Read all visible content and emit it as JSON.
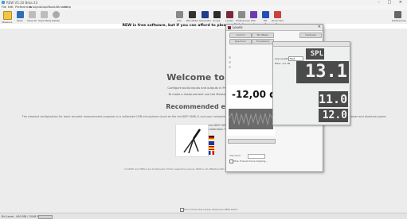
{
  "window": {
    "title": "REW V5.20 Beta 23",
    "controls": "– □ ✕"
  },
  "menu": [
    "File",
    "Edit",
    "Preferences",
    "Analysis",
    "Graph",
    "Tools",
    "Window",
    "Help"
  ],
  "toolbar": {
    "left": [
      {
        "label": "Measure",
        "icon": "measure-icon"
      },
      {
        "label": "Open",
        "icon": "folder-icon"
      },
      {
        "label": "Save All",
        "icon": "save-icon"
      },
      {
        "label": "Save Meas.",
        "icon": "save-icon"
      },
      {
        "label": "Delete",
        "icon": "delete-icon"
      }
    ],
    "right": [
      {
        "label": "Info",
        "icon": "info-icon"
      },
      {
        "label": "RTA Meter",
        "icon": "meter-icon"
      },
      {
        "label": "Generator",
        "icon": "generator-icon"
      },
      {
        "label": "Scope",
        "icon": "scope-icon"
      },
      {
        "label": "Levels",
        "icon": "levels-icon"
      },
      {
        "label": "Preferences",
        "icon": "preferences-icon"
      },
      {
        "label": "RTA",
        "icon": "rta-icon"
      },
      {
        "label": "EQ",
        "icon": "eq-icon"
      },
      {
        "label": "Room Sim",
        "icon": "room-sim-icon"
      }
    ],
    "preferences_label": "Preferences"
  },
  "banner": {
    "before": "REW is free software, but if you can afford to please ",
    "link": "click here",
    "after": " to make a dona"
  },
  "main": {
    "welcome": "Welcome to RE",
    "line1": "Configure audio inputs and outputs in Preferences",
    "line2": "To make a measurement use the Measure button",
    "recommended": "Recommended equip",
    "para": "The simplest configuration for basic acoustic measurement purposes is a calibrated USB microphone (such as the miniDSP UMIK-1) and your computer's headphone output. If that is not available a USB interface with balanced input, phantom power and phantom power.",
    "side_text_1": "miniDSP UM",
    "side_text_2": "calibration fil",
    "footer": "miniDSP and UMIK-1 are trademarks of their respective owners. REW is not affiliated with any of the companies whose products are mentioned.",
    "show_checkbox_label": "Don't show this screen whenever REW starts"
  },
  "status": {
    "left": "Rd Level:",
    "mem": "490 MB / 2048 MB"
  },
  "levels_dialog": {
    "title": "Levels",
    "buttons_row1": [
      "Control",
      "Mic/Meter",
      "Calibrate"
    ],
    "buttons_row2": [
      "Spectrum",
      "Timestamp"
    ],
    "big_level": "-12,00 dB",
    "clip_label": "Clip level",
    "stop_label": "Stop if levels have slipping...",
    "ref_label": "REF"
  },
  "spl_meter": {
    "mode_label": "Avg Length",
    "mode_value": "Fast",
    "filter_label": "Filter: 1/1 dB",
    "weight_label": "SPL",
    "main_reading": "13.1",
    "sub_reading": "11.0",
    "sub_reading_2": "12.0"
  }
}
